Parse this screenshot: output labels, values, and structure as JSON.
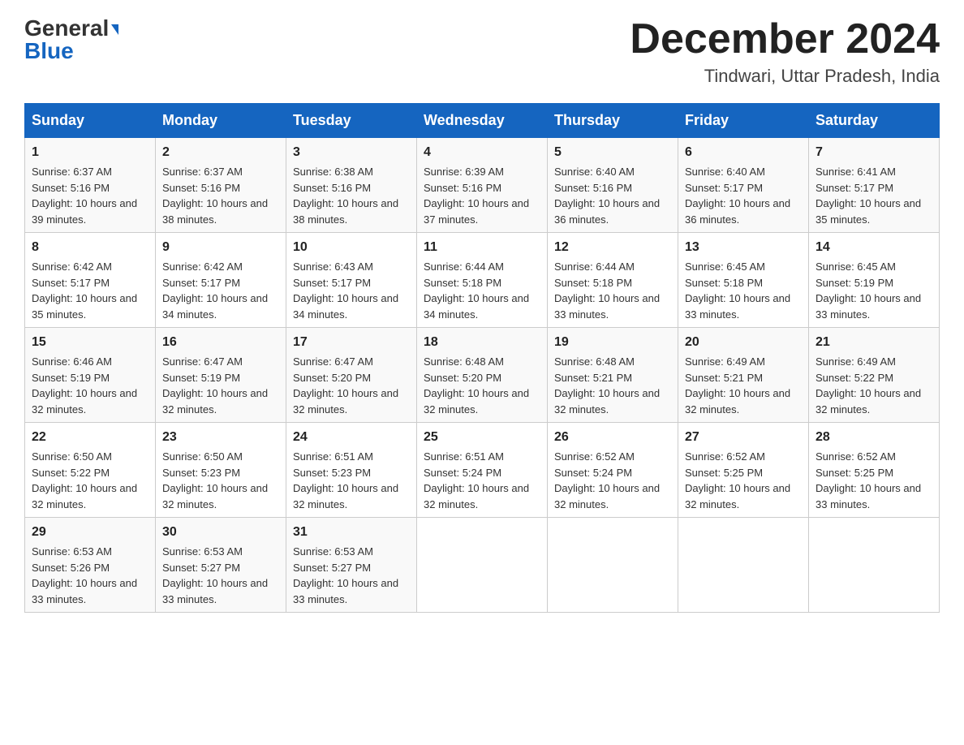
{
  "header": {
    "logo_general": "General",
    "logo_blue": "Blue",
    "month_year": "December 2024",
    "location": "Tindwari, Uttar Pradesh, India"
  },
  "days_of_week": [
    "Sunday",
    "Monday",
    "Tuesday",
    "Wednesday",
    "Thursday",
    "Friday",
    "Saturday"
  ],
  "weeks": [
    [
      {
        "day": "1",
        "sunrise": "6:37 AM",
        "sunset": "5:16 PM",
        "daylight": "10 hours and 39 minutes."
      },
      {
        "day": "2",
        "sunrise": "6:37 AM",
        "sunset": "5:16 PM",
        "daylight": "10 hours and 38 minutes."
      },
      {
        "day": "3",
        "sunrise": "6:38 AM",
        "sunset": "5:16 PM",
        "daylight": "10 hours and 38 minutes."
      },
      {
        "day": "4",
        "sunrise": "6:39 AM",
        "sunset": "5:16 PM",
        "daylight": "10 hours and 37 minutes."
      },
      {
        "day": "5",
        "sunrise": "6:40 AM",
        "sunset": "5:16 PM",
        "daylight": "10 hours and 36 minutes."
      },
      {
        "day": "6",
        "sunrise": "6:40 AM",
        "sunset": "5:17 PM",
        "daylight": "10 hours and 36 minutes."
      },
      {
        "day": "7",
        "sunrise": "6:41 AM",
        "sunset": "5:17 PM",
        "daylight": "10 hours and 35 minutes."
      }
    ],
    [
      {
        "day": "8",
        "sunrise": "6:42 AM",
        "sunset": "5:17 PM",
        "daylight": "10 hours and 35 minutes."
      },
      {
        "day": "9",
        "sunrise": "6:42 AM",
        "sunset": "5:17 PM",
        "daylight": "10 hours and 34 minutes."
      },
      {
        "day": "10",
        "sunrise": "6:43 AM",
        "sunset": "5:17 PM",
        "daylight": "10 hours and 34 minutes."
      },
      {
        "day": "11",
        "sunrise": "6:44 AM",
        "sunset": "5:18 PM",
        "daylight": "10 hours and 34 minutes."
      },
      {
        "day": "12",
        "sunrise": "6:44 AM",
        "sunset": "5:18 PM",
        "daylight": "10 hours and 33 minutes."
      },
      {
        "day": "13",
        "sunrise": "6:45 AM",
        "sunset": "5:18 PM",
        "daylight": "10 hours and 33 minutes."
      },
      {
        "day": "14",
        "sunrise": "6:45 AM",
        "sunset": "5:19 PM",
        "daylight": "10 hours and 33 minutes."
      }
    ],
    [
      {
        "day": "15",
        "sunrise": "6:46 AM",
        "sunset": "5:19 PM",
        "daylight": "10 hours and 32 minutes."
      },
      {
        "day": "16",
        "sunrise": "6:47 AM",
        "sunset": "5:19 PM",
        "daylight": "10 hours and 32 minutes."
      },
      {
        "day": "17",
        "sunrise": "6:47 AM",
        "sunset": "5:20 PM",
        "daylight": "10 hours and 32 minutes."
      },
      {
        "day": "18",
        "sunrise": "6:48 AM",
        "sunset": "5:20 PM",
        "daylight": "10 hours and 32 minutes."
      },
      {
        "day": "19",
        "sunrise": "6:48 AM",
        "sunset": "5:21 PM",
        "daylight": "10 hours and 32 minutes."
      },
      {
        "day": "20",
        "sunrise": "6:49 AM",
        "sunset": "5:21 PM",
        "daylight": "10 hours and 32 minutes."
      },
      {
        "day": "21",
        "sunrise": "6:49 AM",
        "sunset": "5:22 PM",
        "daylight": "10 hours and 32 minutes."
      }
    ],
    [
      {
        "day": "22",
        "sunrise": "6:50 AM",
        "sunset": "5:22 PM",
        "daylight": "10 hours and 32 minutes."
      },
      {
        "day": "23",
        "sunrise": "6:50 AM",
        "sunset": "5:23 PM",
        "daylight": "10 hours and 32 minutes."
      },
      {
        "day": "24",
        "sunrise": "6:51 AM",
        "sunset": "5:23 PM",
        "daylight": "10 hours and 32 minutes."
      },
      {
        "day": "25",
        "sunrise": "6:51 AM",
        "sunset": "5:24 PM",
        "daylight": "10 hours and 32 minutes."
      },
      {
        "day": "26",
        "sunrise": "6:52 AM",
        "sunset": "5:24 PM",
        "daylight": "10 hours and 32 minutes."
      },
      {
        "day": "27",
        "sunrise": "6:52 AM",
        "sunset": "5:25 PM",
        "daylight": "10 hours and 32 minutes."
      },
      {
        "day": "28",
        "sunrise": "6:52 AM",
        "sunset": "5:25 PM",
        "daylight": "10 hours and 33 minutes."
      }
    ],
    [
      {
        "day": "29",
        "sunrise": "6:53 AM",
        "sunset": "5:26 PM",
        "daylight": "10 hours and 33 minutes."
      },
      {
        "day": "30",
        "sunrise": "6:53 AM",
        "sunset": "5:27 PM",
        "daylight": "10 hours and 33 minutes."
      },
      {
        "day": "31",
        "sunrise": "6:53 AM",
        "sunset": "5:27 PM",
        "daylight": "10 hours and 33 minutes."
      },
      null,
      null,
      null,
      null
    ]
  ],
  "labels": {
    "sunrise_prefix": "Sunrise: ",
    "sunset_prefix": "Sunset: ",
    "daylight_prefix": "Daylight: "
  }
}
